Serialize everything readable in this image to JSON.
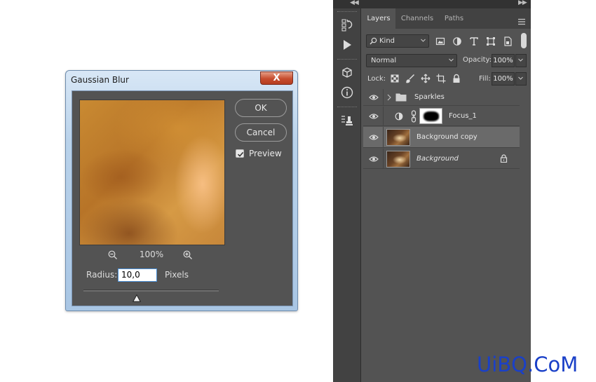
{
  "dialog": {
    "title": "Gaussian Blur",
    "close_symbol": "X",
    "ok_label": "OK",
    "cancel_label": "Cancel",
    "preview_label": "Preview",
    "preview_checked": true,
    "zoom_level": "100%",
    "radius_label": "Radius:",
    "radius_value": "10,0",
    "units_label": "Pixels"
  },
  "panel": {
    "tabs": [
      {
        "label": "Layers",
        "active": true
      },
      {
        "label": "Channels",
        "active": false
      },
      {
        "label": "Paths",
        "active": false
      }
    ],
    "filter_kind": "Kind",
    "blend_mode": "Normal",
    "opacity_label": "Opacity:",
    "opacity_value": "100%",
    "lock_label": "Lock:",
    "fill_label": "Fill:",
    "fill_value": "100%",
    "layers": [
      {
        "name": "Sparkles",
        "type": "group",
        "visible": true,
        "selected": false
      },
      {
        "name": "Focus_1",
        "type": "adjustment",
        "visible": true,
        "selected": false
      },
      {
        "name": "Background copy",
        "type": "pixel",
        "visible": true,
        "selected": true
      },
      {
        "name": "Background",
        "type": "background",
        "visible": true,
        "selected": false,
        "locked": true
      }
    ]
  },
  "watermark": "UiBQ.CoM",
  "colors": {
    "panel_bg": "#535353",
    "selected_row": "#6a6a6a",
    "accent_blue": "#4a8fd6",
    "close_red": "#c74d2e",
    "watermark_blue": "#1a40c8"
  }
}
